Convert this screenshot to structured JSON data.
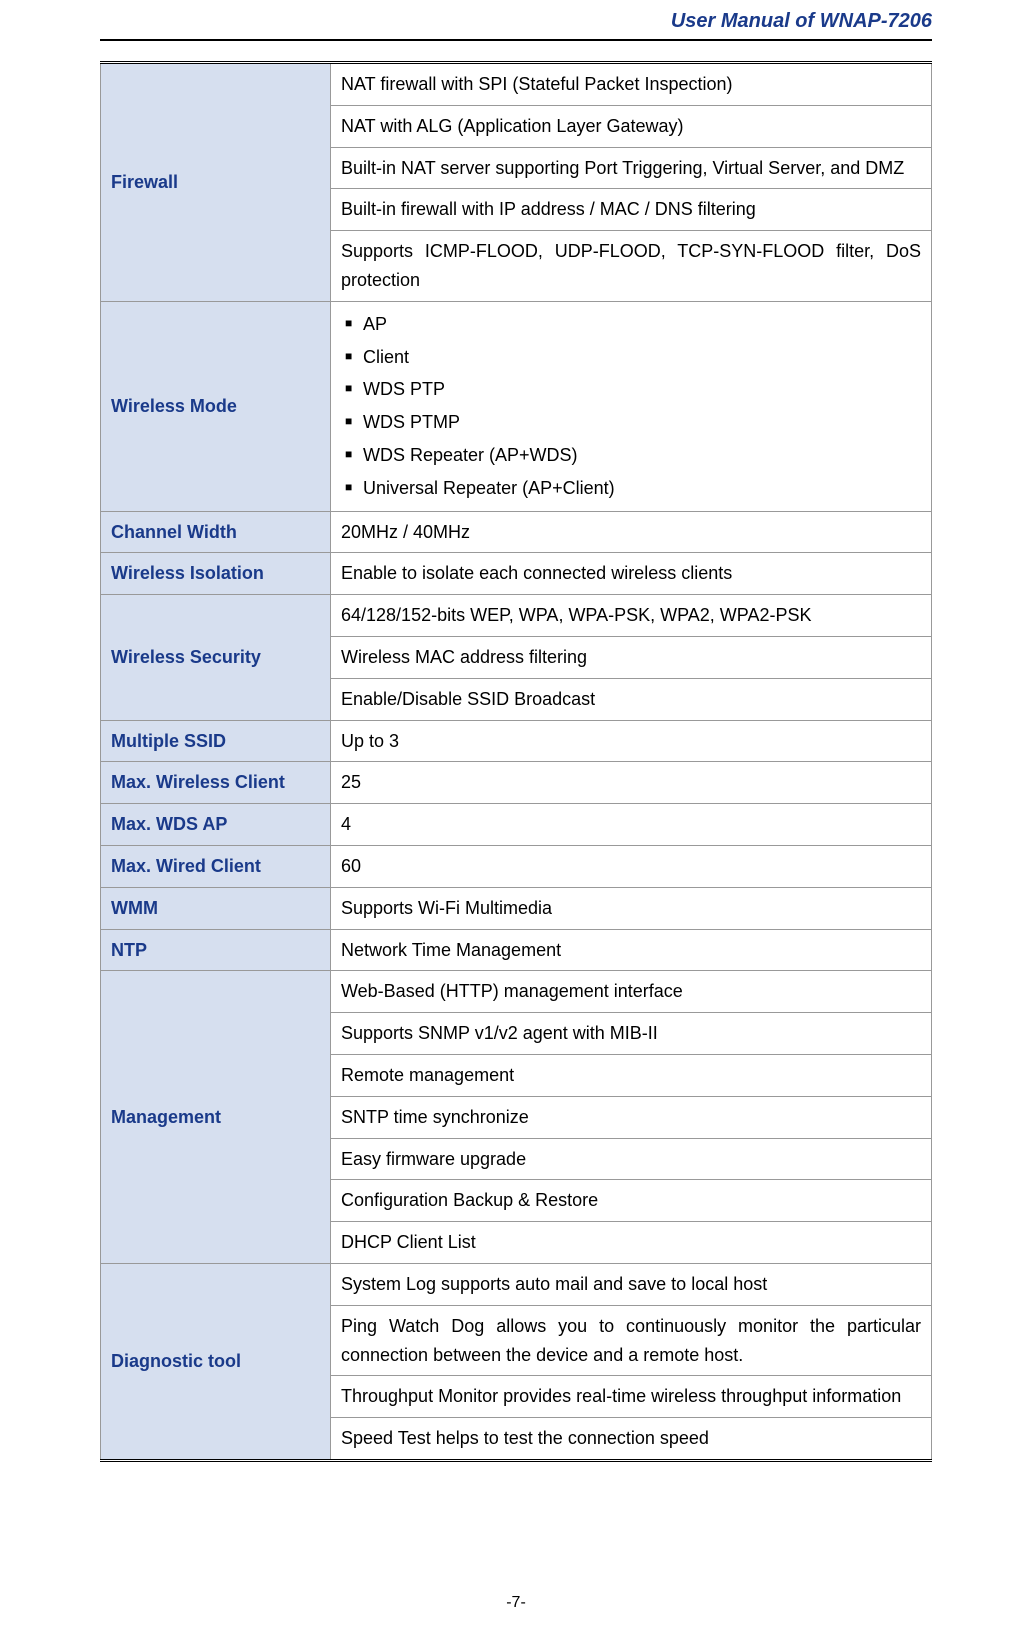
{
  "header": {
    "title": "User Manual of WNAP-7206"
  },
  "footer": {
    "page_num": "-7-"
  },
  "specs": [
    {
      "label": "Firewall",
      "rows": [
        {
          "text": "NAT firewall with SPI (Stateful Packet Inspection)"
        },
        {
          "text": "NAT with ALG (Application Layer Gateway)"
        },
        {
          "text": "Built-in NAT server supporting Port Triggering, Virtual Server, and DMZ"
        },
        {
          "text": "Built-in firewall with IP address / MAC / DNS filtering"
        },
        {
          "text": "Supports ICMP-FLOOD, UDP-FLOOD, TCP-SYN-FLOOD filter, DoS protection",
          "justify": true
        }
      ]
    },
    {
      "label": "Wireless Mode",
      "rows": [
        {
          "bullets": [
            "AP",
            "Client",
            "WDS PTP",
            "WDS PTMP",
            "WDS Repeater (AP+WDS)",
            "Universal Repeater (AP+Client)"
          ]
        }
      ]
    },
    {
      "label": "Channel Width",
      "rows": [
        {
          "text": "20MHz / 40MHz"
        }
      ]
    },
    {
      "label": "Wireless Isolation",
      "rows": [
        {
          "text": "Enable to isolate each connected wireless clients"
        }
      ]
    },
    {
      "label": "Wireless Security",
      "rows": [
        {
          "text": "64/128/152-bits WEP, WPA, WPA-PSK, WPA2, WPA2-PSK"
        },
        {
          "text": "Wireless MAC address filtering"
        },
        {
          "text": "Enable/Disable SSID Broadcast"
        }
      ]
    },
    {
      "label": "Multiple SSID",
      "rows": [
        {
          "text": "Up to 3"
        }
      ]
    },
    {
      "label": "Max. Wireless Client",
      "rows": [
        {
          "text": "25"
        }
      ]
    },
    {
      "label": "Max. WDS AP",
      "rows": [
        {
          "text": "4"
        }
      ]
    },
    {
      "label": "Max. Wired Client",
      "rows": [
        {
          "text": "60"
        }
      ]
    },
    {
      "label": "WMM",
      "rows": [
        {
          "text": "Supports Wi-Fi Multimedia"
        }
      ]
    },
    {
      "label": "NTP",
      "rows": [
        {
          "text": "Network Time Management"
        }
      ]
    },
    {
      "label": "Management",
      "rows": [
        {
          "text": "Web-Based (HTTP) management interface"
        },
        {
          "text": "Supports SNMP v1/v2 agent with MIB-II"
        },
        {
          "text": "Remote management"
        },
        {
          "text": "SNTP time synchronize"
        },
        {
          "text": "Easy firmware upgrade"
        },
        {
          "text": "Configuration Backup & Restore"
        },
        {
          "text": "DHCP Client List"
        }
      ]
    },
    {
      "label": "Diagnostic tool",
      "rows": [
        {
          "text": "System Log supports auto mail and save to local host"
        },
        {
          "text": "Ping Watch Dog allows you to continuously monitor the particular connection between the device and a remote host.",
          "justify": true
        },
        {
          "text": "Throughput Monitor provides real-time wireless throughput information"
        },
        {
          "text": "Speed Test helps to test the connection speed"
        }
      ]
    }
  ]
}
